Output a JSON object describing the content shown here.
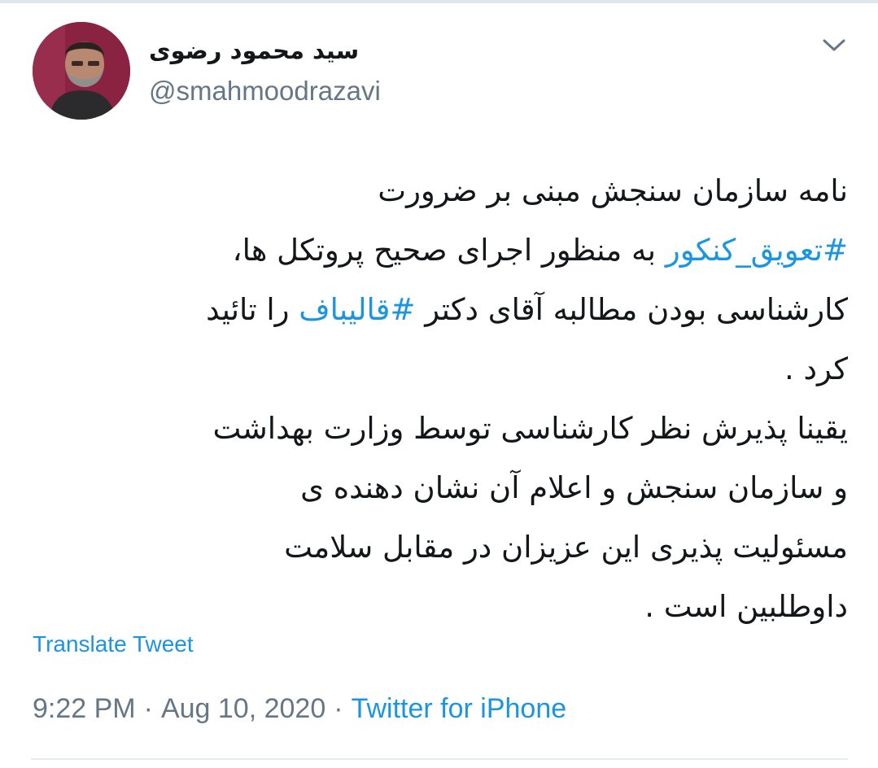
{
  "author": {
    "display_name": "سید محمود رضوی",
    "handle": "@smahmoodrazavi"
  },
  "tweet": {
    "lines": [
      [
        {
          "text": "نامه سازمان سنجش مبنی بر ضرورت",
          "tag": false
        }
      ],
      [
        {
          "text": "#تعویق_کنکور",
          "tag": true
        },
        {
          "text": " به منظور اجرای صحیح پروتکل ها،",
          "tag": false
        }
      ],
      [
        {
          "text": "کارشناسی بودن مطالبه آقای دکتر ",
          "tag": false
        },
        {
          "text": "#قالیباف",
          "tag": true
        },
        {
          "text": " را تائید",
          "tag": false
        }
      ],
      [
        {
          "text": "کرد .",
          "tag": false
        }
      ],
      [
        {
          "text": "یقینا پذیرش نظر کارشناسی توسط وزارت بهداشت",
          "tag": false
        }
      ],
      [
        {
          "text": "و سازمان سنجش و اعلام آن نشان دهنده ی",
          "tag": false
        }
      ],
      [
        {
          "text": "مسئولیت پذیری این عزیزان در مقابل سلامت",
          "tag": false
        }
      ],
      [
        {
          "text": "داوطلبین است .",
          "tag": false
        }
      ]
    ]
  },
  "translate_label": "Translate Tweet",
  "meta": {
    "time": "9:22 PM",
    "separator": "·",
    "date": "Aug 10, 2020",
    "source": "Twitter for iPhone"
  },
  "icons": {
    "menu": "chevron-down-icon",
    "avatar": "avatar"
  },
  "colors": {
    "link": "#1b95e0",
    "secondary_text": "#657786",
    "primary_text": "#14171a"
  }
}
